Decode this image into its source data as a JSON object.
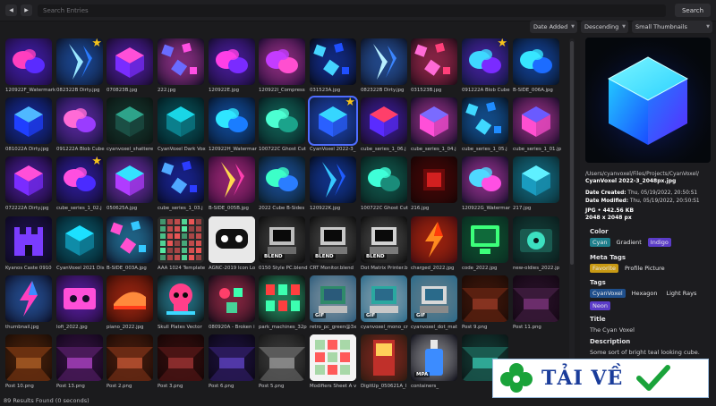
{
  "topbar": {
    "back_glyph": "◀",
    "forward_glyph": "▶",
    "search_placeholder": "Search Entries",
    "search_button": "Search"
  },
  "filters": {
    "sort_field": "Date Added",
    "sort_order": "Descending",
    "thumb_size": "Small Thumbnails"
  },
  "grid": {
    "items": [
      {
        "caption": "120922F_Watermark",
        "art": "blobs",
        "c1": "#ff3fbf",
        "c2": "#5a2bff",
        "c3": "#1d0c3a",
        "star": false,
        "badge": ""
      },
      {
        "caption": "082322B Dirty.jpg",
        "art": "shard",
        "c1": "#9be7ff",
        "c2": "#2a7bff",
        "c3": "#0b1020",
        "star": true,
        "badge": ""
      },
      {
        "caption": "070823B.jpg",
        "art": "cube",
        "c1": "#ff4fd8",
        "c2": "#7a2cff",
        "c3": "#150a25",
        "star": false,
        "badge": ""
      },
      {
        "caption": "222.jpg",
        "art": "scatter",
        "c1": "#6a6bff",
        "c2": "#ff4fe3",
        "c3": "#0b0b1c",
        "star": false,
        "badge": ""
      },
      {
        "caption": "120922E.jpg",
        "art": "blobs",
        "c1": "#ff3fe6",
        "c2": "#7a2bff",
        "c3": "#120b28",
        "star": false,
        "badge": ""
      },
      {
        "caption": "120922I_Compress",
        "art": "blobs",
        "c1": "#c43cff",
        "c2": "#ff4fd0",
        "c3": "#14082a",
        "star": false,
        "badge": ""
      },
      {
        "caption": "031523A.jpg",
        "art": "scatter",
        "c1": "#45d4ff",
        "c2": "#1f4fff",
        "c3": "#05070d",
        "star": false,
        "badge": ""
      },
      {
        "caption": "082322B Dirty.jpg",
        "art": "shard",
        "c1": "#b9f0ff",
        "c2": "#3c86ff",
        "c3": "#0b1020",
        "star": false,
        "badge": ""
      },
      {
        "caption": "031523B.jpg",
        "art": "scatter",
        "c1": "#ff6bd6",
        "c2": "#ff3f7a",
        "c3": "#1a0a14",
        "star": false,
        "badge": ""
      },
      {
        "caption": "091222A Blob Cube",
        "art": "blobs",
        "c1": "#3fd8ff",
        "c2": "#7a2bff",
        "c3": "#0a1530",
        "star": true,
        "badge": ""
      },
      {
        "caption": "B-SIDE_006A.jpg",
        "art": "blobs",
        "c1": "#37e6ff",
        "c2": "#1c6cff",
        "c3": "#07111f",
        "star": false,
        "badge": ""
      },
      {
        "caption": "081022A Dirty.jpg",
        "art": "cube",
        "c1": "#4fb8ff",
        "c2": "#1f3fff",
        "c3": "#0a0f25",
        "star": false,
        "badge": ""
      },
      {
        "caption": "091222A Blob Cube",
        "art": "blobs",
        "c1": "#ff6bd6",
        "c2": "#9a3cff",
        "c3": "#101030",
        "star": false,
        "badge": ""
      },
      {
        "caption": "cyanvoxel_shattere",
        "art": "cube",
        "c1": "#2ea38a",
        "c2": "#1b4f45",
        "c3": "#0b1310",
        "star": false,
        "badge": ""
      },
      {
        "caption": "CyanVoxel Dark Vox",
        "art": "cube",
        "c1": "#19d6e6",
        "c2": "#0b7f8c",
        "c3": "#03181c",
        "star": false,
        "badge": ""
      },
      {
        "caption": "120922H_Watermar",
        "art": "blobs",
        "c1": "#2fe6ff",
        "c2": "#1a7dff",
        "c3": "#061224",
        "star": false,
        "badge": ""
      },
      {
        "caption": "100722C Ghost Cut",
        "art": "blobs",
        "c1": "#4cffd2",
        "c2": "#1ba38b",
        "c3": "#06161a",
        "star": false,
        "badge": ""
      },
      {
        "caption": "CyanVoxel 2022-3_",
        "art": "cube",
        "c1": "#36d6ff",
        "c2": "#2a60ff",
        "c3": "#0b1a40",
        "star": true,
        "badge": "",
        "sel": true
      },
      {
        "caption": "cube_series_1_06.j",
        "art": "cube",
        "c1": "#ff3f6a",
        "c2": "#5a2bff",
        "c3": "#150a1c",
        "star": false,
        "badge": ""
      },
      {
        "caption": "cube_series_1_04.j",
        "art": "cube",
        "c1": "#7a6bff",
        "c2": "#ff4fd8",
        "c3": "#0c0a20",
        "star": false,
        "badge": ""
      },
      {
        "caption": "cube_series_1_05.j",
        "art": "scatter",
        "c1": "#3fd8ff",
        "c2": "#1f8cff",
        "c3": "#06101c",
        "star": false,
        "badge": ""
      },
      {
        "caption": "cube_series_1_01.jp",
        "art": "cube",
        "c1": "#6a5bff",
        "c2": "#ff4fd0",
        "c3": "#120a24",
        "star": false,
        "badge": ""
      },
      {
        "caption": "072222A Dirty.jpg",
        "art": "cube",
        "c1": "#ff4fd8",
        "c2": "#7a2cff",
        "c3": "#10081e",
        "star": false,
        "badge": ""
      },
      {
        "caption": "cube_series_1_02.j",
        "art": "blobs",
        "c1": "#ff4fe0",
        "c2": "#4a2bff",
        "c3": "#0e0a22",
        "star": true,
        "badge": ""
      },
      {
        "caption": "050625A.jpg",
        "art": "cube",
        "c1": "#34e2ff",
        "c2": "#b03cff",
        "c3": "#10122a",
        "star": false,
        "badge": ""
      },
      {
        "caption": "cube_series_1_03.j",
        "art": "scatter",
        "c1": "#4fa8ff",
        "c2": "#2b3cff",
        "c3": "#05081a",
        "star": false,
        "badge": ""
      },
      {
        "caption": "B-SIDE_005B.jpg",
        "art": "shard",
        "c1": "#ffd84f",
        "c2": "#ff3fb0",
        "c3": "#2a0a30",
        "star": false,
        "badge": ""
      },
      {
        "caption": "2022 Cube B-Sides",
        "art": "blobs",
        "c1": "#3cffc8",
        "c2": "#2a7dff",
        "c3": "#08161a",
        "star": false,
        "badge": ""
      },
      {
        "caption": "120922K.jpg",
        "art": "shard",
        "c1": "#36c8ff",
        "c2": "#1f5cff",
        "c3": "#040a18",
        "star": false,
        "badge": ""
      },
      {
        "caption": "100722C Ghost Cut",
        "art": "blobs",
        "c1": "#3fffd8",
        "c2": "#1a8c7a",
        "c3": "#071a18",
        "star": false,
        "badge": ""
      },
      {
        "caption": "216.jpg",
        "art": "glow",
        "c1": "#ff2a2a",
        "c2": "#6a0a0a",
        "c3": "#150404",
        "star": false,
        "badge": ""
      },
      {
        "caption": "120922G_Watermar",
        "art": "blobs",
        "c1": "#4fd8ff",
        "c2": "#ff4fe3",
        "c3": "#0e0c24",
        "star": false,
        "badge": ""
      },
      {
        "caption": "217.jpg",
        "art": "cube",
        "c1": "#5ff0ff",
        "c2": "#1a9cc0",
        "c3": "#0a2a30",
        "star": false,
        "badge": ""
      },
      {
        "caption": "Kyanos Caste 0910",
        "art": "castle",
        "c1": "#7a3cff",
        "c2": "#2b1a6a",
        "c3": "#0c0820",
        "star": false,
        "badge": ""
      },
      {
        "caption": "CyanVoxel 2021 Dis",
        "art": "cube",
        "c1": "#1ce0ff",
        "c2": "#0f8ca8",
        "c3": "#041820",
        "star": false,
        "badge": ""
      },
      {
        "caption": "B-SIDE_003A.jpg",
        "art": "scatter",
        "c1": "#ff4fd0",
        "c2": "#34c8ff",
        "c3": "#0c0a1c",
        "star": false,
        "badge": ""
      },
      {
        "caption": "AAA 1024 Template",
        "art": "grid",
        "c1": "#ff5a5a",
        "c2": "#5affb0",
        "c3": "#2a2a2a",
        "star": false,
        "badge": ""
      },
      {
        "caption": "AGNC-2019 Icon Lo",
        "art": "pad",
        "c1": "#ffffff",
        "c2": "#111111",
        "c3": "#e8e8e8",
        "star": false,
        "badge": ""
      },
      {
        "caption": "0150 Style PC.blend",
        "art": "pc",
        "c1": "#bdbdbd",
        "c2": "#6a6a6a",
        "c3": "#0a0a0a",
        "star": false,
        "badge": "BLEND"
      },
      {
        "caption": "CRT Monitor.blend",
        "art": "pc",
        "c1": "#c8c8c8",
        "c2": "#777777",
        "c3": "#0a0a0a",
        "star": false,
        "badge": "BLEND"
      },
      {
        "caption": "Dot Matrix Printer.b",
        "art": "pc",
        "c1": "#d2d2d2",
        "c2": "#7a7a7a",
        "c3": "#0a0a0a",
        "star": false,
        "badge": "BLEND"
      },
      {
        "caption": "charged_2022.jpg",
        "art": "bolt",
        "c1": "#ff8a1f",
        "c2": "#ff3a0a",
        "c3": "#3a0a10",
        "star": false,
        "badge": ""
      },
      {
        "caption": "code_2022.jpg",
        "art": "monitor",
        "c1": "#3cff7a",
        "c2": "#0f6a3a",
        "c3": "#0a2a20",
        "star": false,
        "badge": ""
      },
      {
        "caption": "new-oldies_2022.jp",
        "art": "disc",
        "c1": "#3ce0c0",
        "c2": "#1a5a50",
        "c3": "#0a1a1a",
        "star": false,
        "badge": ""
      },
      {
        "caption": "thumbnail.jpg",
        "art": "bolt",
        "c1": "#ff3fbf",
        "c2": "#3c8cff",
        "c3": "#0a0a1c",
        "star": false,
        "badge": ""
      },
      {
        "caption": "lofi_2022.jpg",
        "art": "tape",
        "c1": "#ff4fd8",
        "c2": "#8a2cff",
        "c3": "#1a0a2a",
        "star": false,
        "badge": ""
      },
      {
        "caption": "piano_2022.jpg",
        "art": "piano",
        "c1": "#ff8a3c",
        "c2": "#ff3c1a",
        "c3": "#2a0a05",
        "star": false,
        "badge": ""
      },
      {
        "caption": "Skull Plates Vector",
        "art": "skull",
        "c1": "#ff3f8a",
        "c2": "#3cd8ff",
        "c3": "#0a0a0a",
        "star": false,
        "badge": ""
      },
      {
        "caption": "080920A - Broken i",
        "art": "gems",
        "c1": "#3cffb0",
        "c2": "#ff3f6a",
        "c3": "#0a0a14",
        "star": false,
        "badge": ""
      },
      {
        "caption": "park_machines_32p",
        "art": "robots",
        "c1": "#ff3f3f",
        "c2": "#3cffb0",
        "c3": "#0a0a0a",
        "star": false,
        "badge": ""
      },
      {
        "caption": "retro_pc_green@3x",
        "art": "pc",
        "c1": "#2f8a6a",
        "c2": "#bdbdbd",
        "c3": "#2a5a7a",
        "star": false,
        "badge": "GIF"
      },
      {
        "caption": "cyanvoxel_mono_cr",
        "art": "pc",
        "c1": "#2aa8a0",
        "c2": "#c8c8c8",
        "c3": "#2a6a8a",
        "star": false,
        "badge": "GIF"
      },
      {
        "caption": "cyanvoxel_dot_mat",
        "art": "pc",
        "c1": "#d8d8d8",
        "c2": "#8a8a8a",
        "c3": "#2a6a8a",
        "star": false,
        "badge": "GIF"
      },
      {
        "caption": "Post 9.png",
        "art": "room",
        "c1": "#a8402a",
        "c2": "#5a2010",
        "c3": "#1a0a05",
        "star": false,
        "badge": ""
      },
      {
        "caption": "Post 11.png",
        "art": "room",
        "c1": "#8a3a8a",
        "c2": "#3a1a3a",
        "c3": "#120612",
        "star": false,
        "badge": ""
      },
      {
        "caption": "Post 10.png",
        "art": "room",
        "c1": "#c06a2a",
        "c2": "#6a3010",
        "c3": "#1a0c05",
        "star": false,
        "badge": ""
      },
      {
        "caption": "Post 13.png",
        "art": "room",
        "c1": "#c04ad8",
        "c2": "#4a1a5a",
        "c3": "#12061a",
        "star": false,
        "badge": ""
      },
      {
        "caption": "Post 2.png",
        "art": "room",
        "c1": "#d8603a",
        "c2": "#6a2a14",
        "c3": "#1a0a05",
        "star": false,
        "badge": ""
      },
      {
        "caption": "Post 3.png",
        "art": "room",
        "c1": "#b03a3a",
        "c2": "#4a1414",
        "c3": "#140505",
        "star": false,
        "badge": ""
      },
      {
        "caption": "Post 6.png",
        "art": "room",
        "c1": "#6a4ad8",
        "c2": "#2a1a5a",
        "c3": "#0a0614",
        "star": false,
        "badge": ""
      },
      {
        "caption": "Post 5.png",
        "art": "room",
        "c1": "#a8a8a8",
        "c2": "#5a5a5a",
        "c3": "#141414",
        "star": false,
        "badge": ""
      },
      {
        "caption": "Modifiers Sheet A v",
        "art": "sheet",
        "c1": "#e8e8e8",
        "c2": "#ff5a5a",
        "c3": "#f4f4f4",
        "star": false,
        "badge": ""
      },
      {
        "caption": "DigitUp_050621A_l",
        "art": "arcade",
        "c1": "#ffcf5a",
        "c2": "#c0302a",
        "c3": "#2a1a10",
        "star": false,
        "badge": ""
      },
      {
        "caption": "containers_",
        "art": "bottle",
        "c1": "#3c8cff",
        "c2": "#e8e8e8",
        "c3": "#0a0a14",
        "star": false,
        "badge": "MPA"
      },
      {
        "caption": "",
        "art": "room",
        "c1": "#3cd8c0",
        "c2": "#1a5a50",
        "c3": "#0a1414",
        "star": false,
        "badge": ""
      }
    ]
  },
  "preview": {
    "path": "/Users/cyanvoxel/Files/Projects/CyanVoxel/",
    "filename": "CyanVoxel 2022-3_2048px.jpg",
    "date_created_label": "Date Created:",
    "date_created": "Thu, 05/19/2022, 20:50:S1",
    "date_modified_label": "Date Modified:",
    "date_modified": "Thu, 05/19/2022, 20:50:S1",
    "format_size": "JPG • 442.56 KB",
    "dimensions": "2048 x 2048 px"
  },
  "fields": {
    "color_label": "Color",
    "color_tags": [
      {
        "text": "Cyan",
        "bg": "#1f7f8c"
      },
      {
        "text": "Gradient",
        "bg": ""
      },
      {
        "text": "Indigo",
        "bg": "#5b3cc8"
      }
    ],
    "meta_label": "Meta Tags",
    "meta_tags": [
      {
        "text": "Favorite",
        "bg": "#c89a14"
      },
      {
        "text": "Profile Picture",
        "bg": ""
      }
    ],
    "tags_label": "Tags",
    "tags": [
      {
        "text": "CyanVoxel",
        "bg": "#1f4f8c"
      },
      {
        "text": "Hexagon",
        "bg": ""
      },
      {
        "text": "Light Rays",
        "bg": ""
      },
      {
        "text": "Neon",
        "bg": "#5b3cc8"
      }
    ],
    "title_label": "Title",
    "title_value": "The Cyan Voxel",
    "desc_label": "Description",
    "desc_value": "Some sort of bright teal looking cube."
  },
  "status": "89 Results Found (0 seconds)",
  "watermark": {
    "text": "TẢI VỀ",
    "clover_color": "#1aa33a",
    "check_color": "#1aa33a"
  }
}
